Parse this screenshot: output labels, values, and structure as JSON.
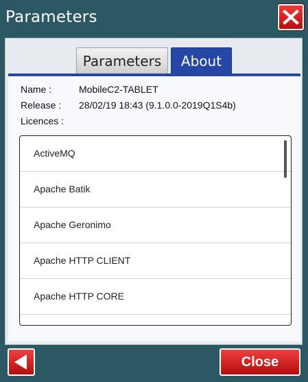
{
  "window": {
    "title": "Parameters"
  },
  "tabs": [
    {
      "label": "Parameters",
      "active": false
    },
    {
      "label": "About",
      "active": true
    }
  ],
  "about": {
    "name_label": "Name :",
    "name_value": "MobileC2-TABLET",
    "release_label": "Release :",
    "release_value": "28/02/19 18:43 (9.1.0.0-2019Q1S4b)",
    "licences_label": "Licences :",
    "licences": [
      "ActiveMQ",
      "Apache Batik",
      "Apache Geronimo",
      "Apache HTTP CLIENT",
      "Apache HTTP CORE"
    ]
  },
  "footer": {
    "close_label": "Close"
  },
  "colors": {
    "accent": "#2647a6",
    "danger": "#d01c1c",
    "background": "#2c5863"
  },
  "icons": {
    "window_close": "close-icon",
    "back": "back-arrow-icon"
  }
}
